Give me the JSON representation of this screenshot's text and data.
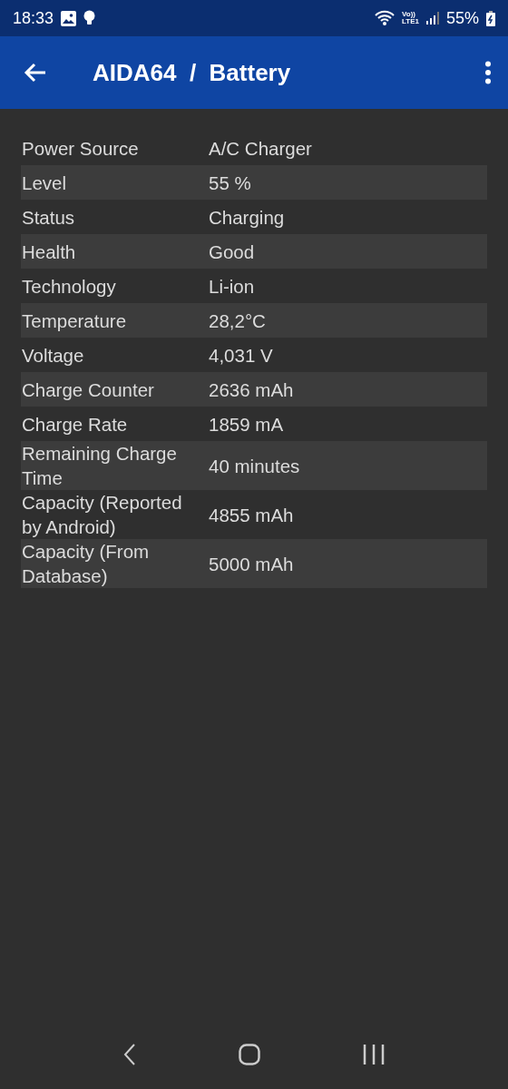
{
  "status_bar": {
    "time": "18:33",
    "network_top": "Vo))",
    "network_bottom": "LTE1",
    "battery": "55%"
  },
  "app_bar": {
    "title": "AIDA64  /  Battery"
  },
  "rows": [
    {
      "label": "Power Source",
      "value": "A/C Charger"
    },
    {
      "label": "Level",
      "value": "55 %"
    },
    {
      "label": "Status",
      "value": "Charging"
    },
    {
      "label": "Health",
      "value": "Good"
    },
    {
      "label": "Technology",
      "value": "Li-ion"
    },
    {
      "label": "Temperature",
      "value": "28,2°C"
    },
    {
      "label": "Voltage",
      "value": "4,031 V"
    },
    {
      "label": "Charge Counter",
      "value": "2636 mAh"
    },
    {
      "label": "Charge Rate",
      "value": "1859 mA"
    },
    {
      "label": "Remaining Charge Time",
      "value": "40 minutes"
    },
    {
      "label": "Capacity (Reported by Android)",
      "value": "4855 mAh"
    },
    {
      "label": "Capacity (From Database)",
      "value": "5000 mAh"
    }
  ]
}
